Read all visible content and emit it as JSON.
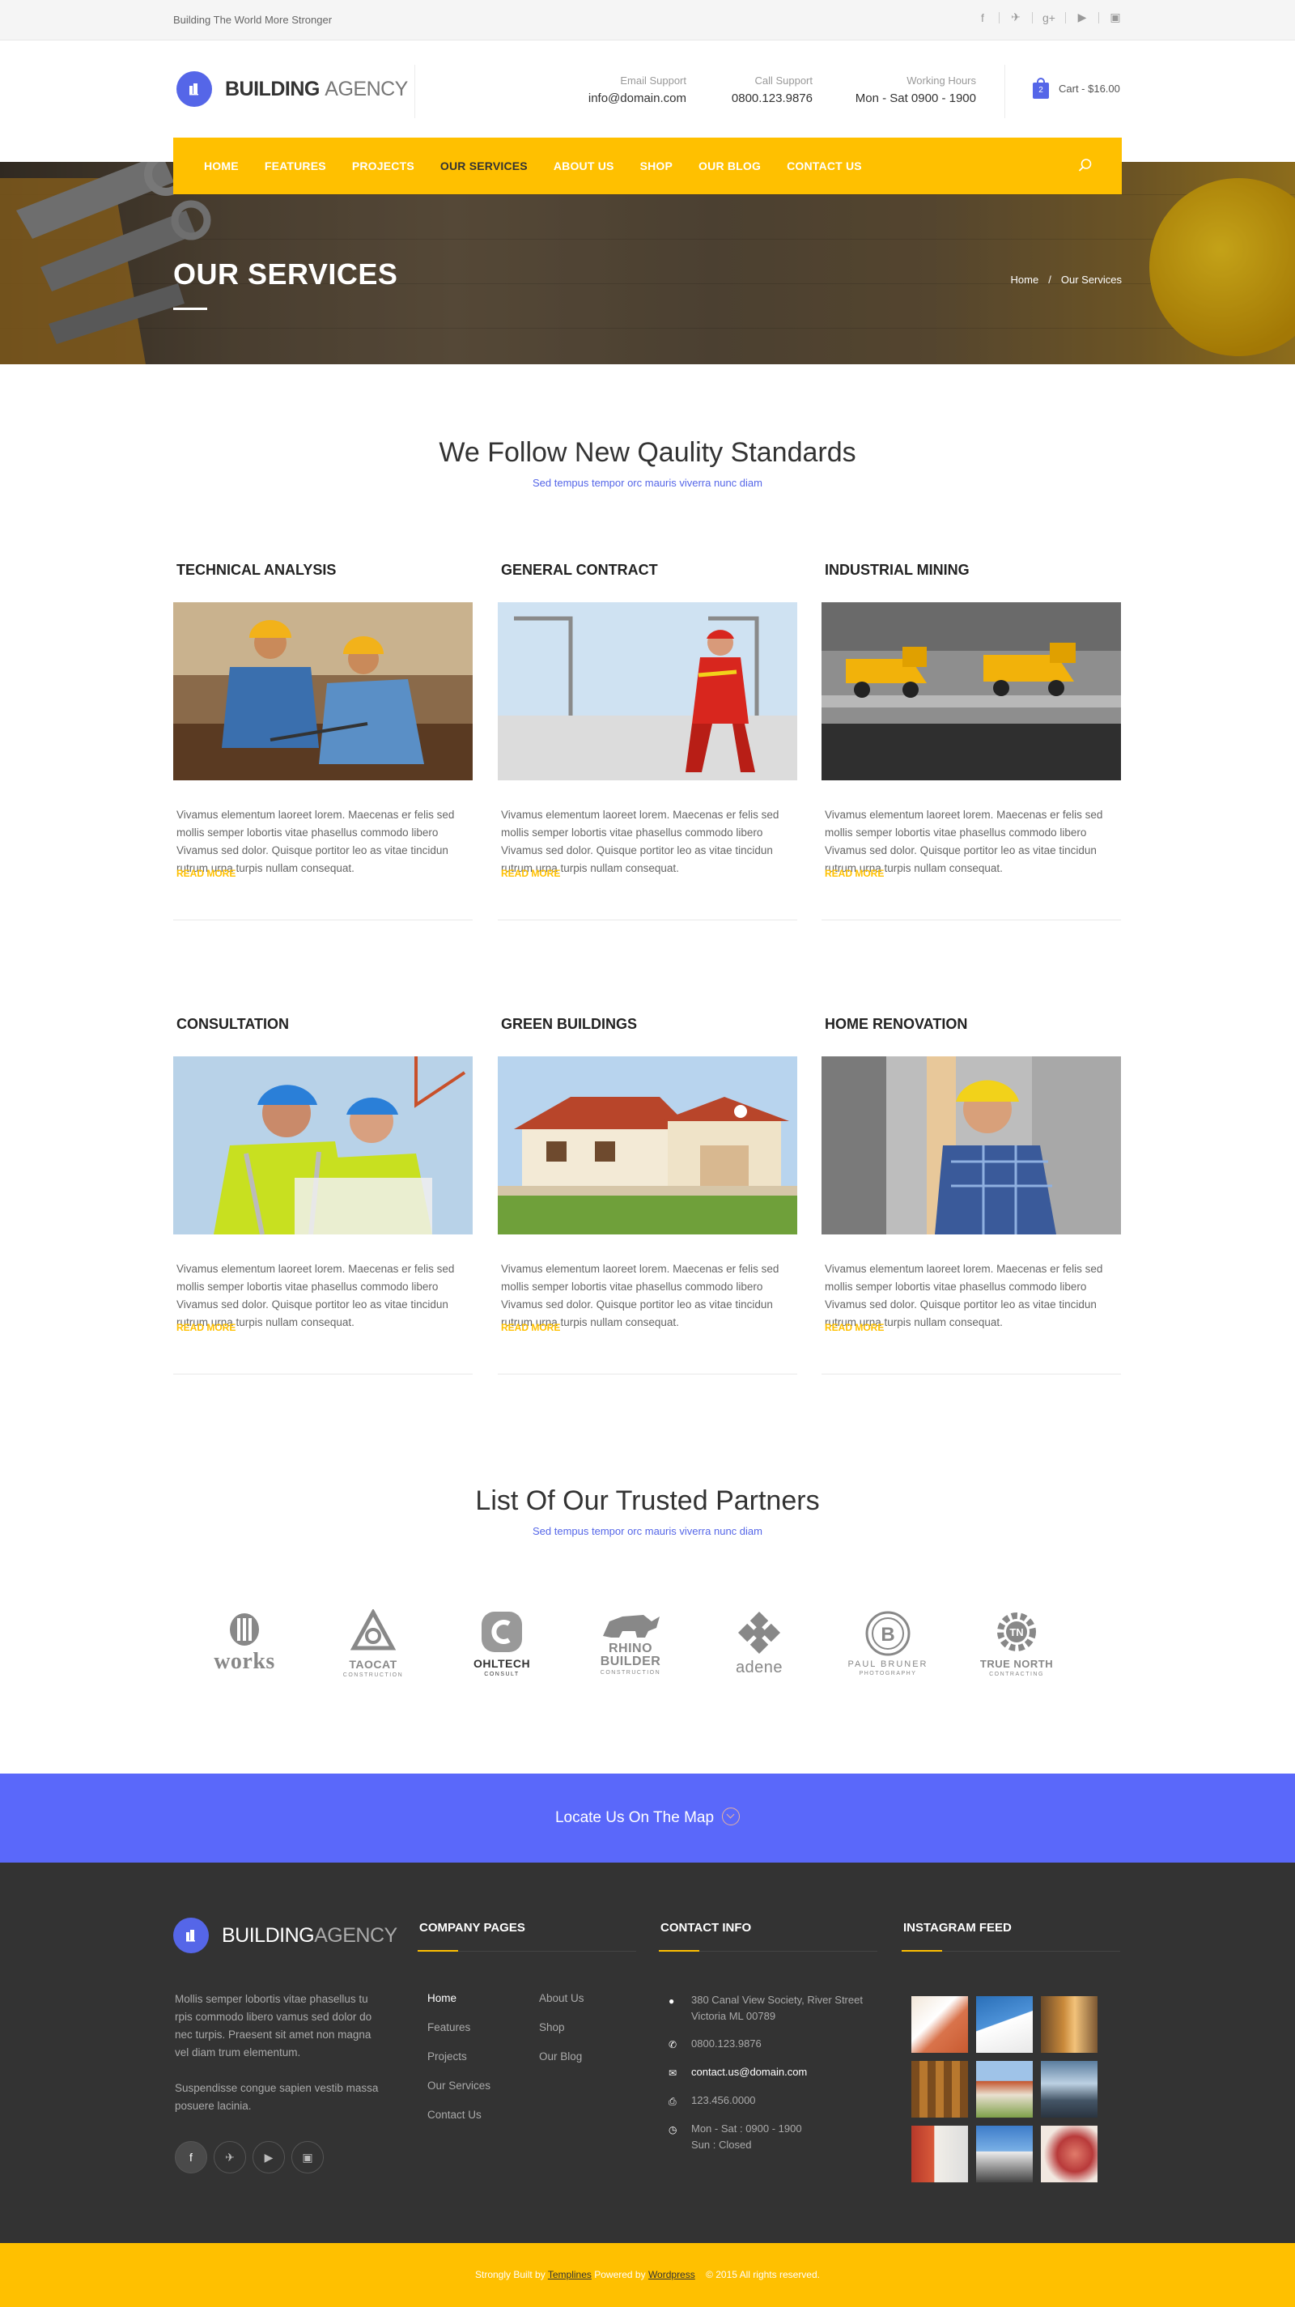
{
  "topbar": {
    "tagline": "Building The World More Stronger",
    "social": [
      "facebook-icon",
      "twitter-icon",
      "google-plus-icon",
      "youtube-icon",
      "instagram-icon"
    ],
    "social_glyphs": [
      "f",
      "✈",
      "g+",
      "▶",
      "▣"
    ]
  },
  "header": {
    "logo_bold": "BUILDING",
    "logo_light": "AGENCY",
    "email_label": "Email Support",
    "email_value": "info@domain.com",
    "call_label": "Call Support",
    "call_value": "0800.123.9876",
    "hours_label": "Working Hours",
    "hours_value": "Mon - Sat 0900 - 1900",
    "cart_count": "2",
    "cart_label": "Cart - $16.00"
  },
  "nav": {
    "items": [
      "HOME",
      "FEATURES",
      "PROJECTS",
      "OUR SERVICES",
      "ABOUT US",
      "SHOP",
      "OUR BLOG",
      "CONTACT US"
    ],
    "active": "OUR SERVICES"
  },
  "hero": {
    "title": "OUR SERVICES",
    "crumb_home": "Home",
    "crumb_sep": "/",
    "crumb_current": "Our Services"
  },
  "services_section": {
    "title": "We Follow New Qaulity Standards",
    "subtitle": "Sed tempus tempor orc mauris viverra nunc diam"
  },
  "services": [
    {
      "title": "TECHNICAL ANALYSIS",
      "desc": "Vivamus elementum laoreet lorem. Maecenas er felis sed mollis semper lobortis vitae phasellus commodo libero Vivamus sed dolor. Quisque portitor leo as vitae tincidun rutrum urna turpis nullam consequat.",
      "more": "READ MORE"
    },
    {
      "title": "GENERAL CONTRACT",
      "desc": "Vivamus elementum laoreet lorem. Maecenas er felis sed mollis semper lobortis vitae phasellus commodo libero Vivamus sed dolor. Quisque portitor leo as vitae tincidun rutrum urna turpis nullam consequat.",
      "more": "READ MORE"
    },
    {
      "title": "INDUSTRIAL MINING",
      "desc": "Vivamus elementum laoreet lorem. Maecenas er felis sed mollis semper lobortis vitae phasellus commodo libero Vivamus sed dolor. Quisque portitor leo as vitae tincidun rutrum urna turpis nullam consequat.",
      "more": "READ MORE"
    },
    {
      "title": "CONSULTATION",
      "desc": "Vivamus elementum laoreet lorem. Maecenas er felis sed mollis semper lobortis vitae phasellus commodo libero Vivamus sed dolor. Quisque portitor leo as vitae tincidun rutrum urna turpis nullam consequat.",
      "more": "READ MORE"
    },
    {
      "title": "GREEN BUILDINGS",
      "desc": "Vivamus elementum laoreet lorem. Maecenas er felis sed mollis semper lobortis vitae phasellus commodo libero Vivamus sed dolor. Quisque portitor leo as vitae tincidun rutrum urna turpis nullam consequat.",
      "more": "READ MORE"
    },
    {
      "title": "HOME RENOVATION",
      "desc": "Vivamus elementum laoreet lorem. Maecenas er felis sed mollis semper lobortis vitae phasellus commodo libero Vivamus sed dolor. Quisque portitor leo as vitae tincidun rutrum urna turpis nullam consequat.",
      "more": "READ MORE"
    }
  ],
  "partners_section": {
    "title": "List Of Our Trusted Partners",
    "subtitle": "Sed tempus tempor orc mauris viverra nunc diam"
  },
  "partners": [
    {
      "name": "works",
      "sub": ""
    },
    {
      "name": "TAOCAT",
      "sub": "CONSTRUCTION"
    },
    {
      "name": "OHLTECH",
      "sub": "CONSULT"
    },
    {
      "name": "RHINO BUILDER",
      "sub": "CONSTRUCTION"
    },
    {
      "name": "adene",
      "sub": ""
    },
    {
      "name": "PAUL BRUNER",
      "sub": "PHOTOGRAPHY"
    },
    {
      "name": "TRUE NORTH",
      "sub": "CONTRACTING"
    }
  ],
  "locate": {
    "label": "Locate Us On The Map"
  },
  "footer": {
    "logo_bold": "BUILDING",
    "logo_light": "AGENCY",
    "about_1": "Mollis semper lobortis vitae phasellus tu rpis commodo libero vamus sed dolor do nec turpis. Praesent sit amet non magna vel diam trum elementum.",
    "about_2": "Suspendisse congue sapien vestib massa posuere lacinia.",
    "social_glyphs": [
      "f",
      "✈",
      "▶",
      "▣"
    ],
    "company_title": "COMPANY PAGES",
    "pages_left": [
      "Home",
      "Features",
      "Projects",
      "Our Services",
      "Contact Us"
    ],
    "pages_right": [
      "About Us",
      "Shop",
      "Our Blog"
    ],
    "contact_title": "CONTACT INFO",
    "address": "380 Canal View Society, River Street Victoria ML 00789",
    "phone": "0800.123.9876",
    "email": "contact.us@domain.com",
    "fax": "123.456.0000",
    "hours_1": "Mon - Sat : 0900 - 1900",
    "hours_2": "Sun : Closed",
    "instagram_title": "INSTAGRAM FEED"
  },
  "copyright": {
    "prefix": "Strongly Built by",
    "templines": "Templines",
    "powered": "Powered by",
    "wordpress": "Wordpress",
    "year": "© 2015 All rights reserved."
  }
}
